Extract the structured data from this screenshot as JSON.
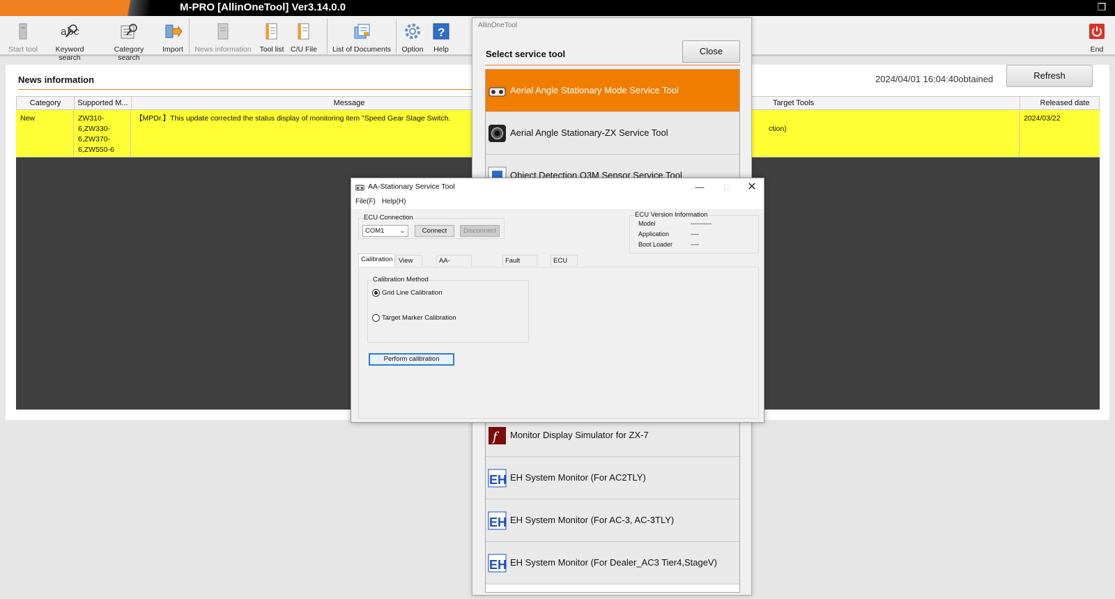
{
  "window": {
    "title": "M-PRO [AllinOneTool] Ver3.14.0.0"
  },
  "toolbar": {
    "items": [
      {
        "label": "Start tool",
        "icon": "start-tool-icon"
      },
      {
        "label": "Keyword search",
        "icon": "keyword-search-icon"
      },
      {
        "label": "Category search",
        "icon": "category-search-icon"
      },
      {
        "label": "Import",
        "icon": "import-icon"
      },
      {
        "label": "News information",
        "icon": "news-icon"
      },
      {
        "label": "Tool list",
        "icon": "tool-list-icon"
      },
      {
        "label": "C/U File",
        "icon": "cu-file-icon"
      },
      {
        "label": "List of Documents",
        "icon": "documents-icon"
      },
      {
        "label": "Option",
        "icon": "gear-icon"
      },
      {
        "label": "Help",
        "icon": "help-icon"
      }
    ],
    "end_label": "End"
  },
  "news": {
    "title": "News information",
    "obtained": "2024/04/01 16:04:40obtained",
    "refresh_label": "Refresh",
    "columns": [
      "Category",
      "Supported M...",
      "Message",
      "Target Tools",
      "Released date"
    ],
    "rows": [
      {
        "category": "New",
        "models": "ZW310-6,ZW330-6,ZW370-6,ZW550-6",
        "message": "【MPDr.】This update corrected the status display of monitoring item \"Speed Gear Stage Switch.",
        "target": "ction)",
        "released": "2024/03/22"
      }
    ]
  },
  "service_popup": {
    "window_title": "AllinOneTool",
    "heading": "Select service tool",
    "close_label": "Close",
    "items": [
      {
        "label": "Aerial Angle Stationary Mode Service Tool",
        "active": true
      },
      {
        "label": "Aerial Angle Stationary-ZX Service Tool"
      },
      {
        "label": "Object Detection O3M Sensor Service Tool"
      },
      {
        "label": "Monitor Display Simulator for ZX-7"
      },
      {
        "label": "EH System Monitor (For AC2TLY)"
      },
      {
        "label": "EH System Monitor (For AC-3, AC-3TLY)"
      },
      {
        "label": "EH System Monitor (For Dealer_AC3 Tier4,StageV)"
      }
    ]
  },
  "dialog": {
    "title": "AA-Stationary Service Tool",
    "menu": [
      "File(F)",
      "Help(H)"
    ],
    "ecu_connection": {
      "label": "ECU Connection",
      "port": "COM1",
      "connect_label": "Connect",
      "disconnect_label": "Disconnect"
    },
    "ecu_version": {
      "label": "ECU Version Information",
      "rows": [
        {
          "key": "Model",
          "value": "----------"
        },
        {
          "key": "Application",
          "value": "----"
        },
        {
          "key": "Boot Loader",
          "value": "----"
        }
      ]
    },
    "tabs": [
      "Calibration",
      "View Setting",
      "AA-Stationary Setting",
      "Fault Diagnosis",
      "ECU Control"
    ],
    "calibration": {
      "group_label": "Calibration Method",
      "option1": "Grid Line Calibration",
      "option2": "Target Marker Calibration",
      "perform_label": "Perform calibration"
    }
  },
  "colors": {
    "accent": "#ef7d00",
    "highlight_row": "#ffff33"
  }
}
